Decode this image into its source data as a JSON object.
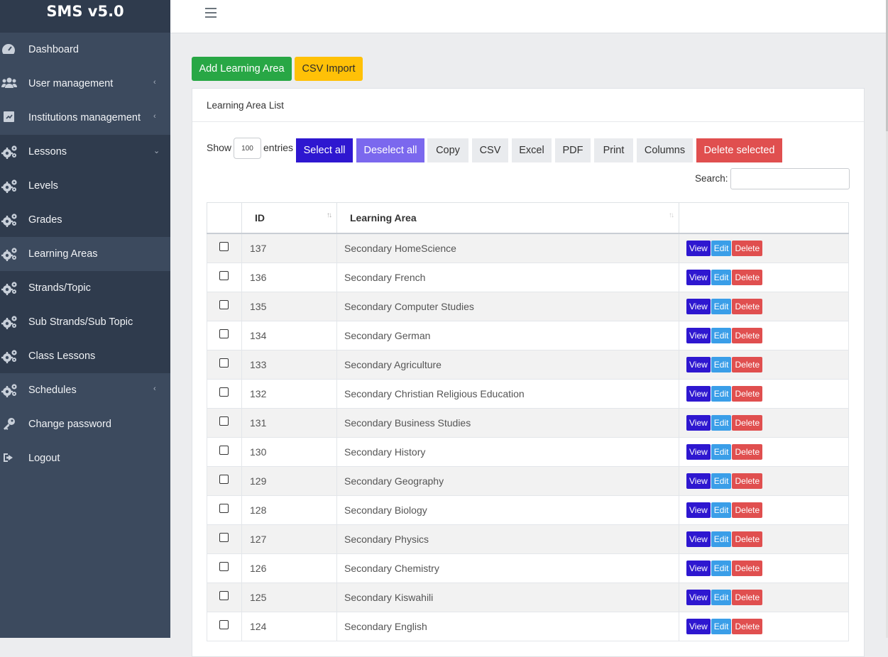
{
  "app": {
    "title": "SMS v5.0"
  },
  "sidebar": {
    "items": [
      {
        "label": "Dashboard",
        "icon": "dashboard-icon",
        "caret": ""
      },
      {
        "label": "User management",
        "icon": "users-icon",
        "caret": "‹"
      },
      {
        "label": "Institutions management",
        "icon": "institution-icon",
        "caret": "‹"
      },
      {
        "label": "Lessons",
        "icon": "cogs-icon",
        "caret": "⌄"
      },
      {
        "label": "Levels",
        "icon": "cogs-icon",
        "caret": ""
      },
      {
        "label": "Grades",
        "icon": "cogs-icon",
        "caret": ""
      },
      {
        "label": "Learning Areas",
        "icon": "cogs-icon",
        "caret": ""
      },
      {
        "label": "Strands/Topic",
        "icon": "cogs-icon",
        "caret": ""
      },
      {
        "label": "Sub Strands/Sub Topic",
        "icon": "cogs-icon",
        "caret": ""
      },
      {
        "label": "Class Lessons",
        "icon": "cogs-icon",
        "caret": ""
      },
      {
        "label": "Schedules",
        "icon": "cogs-icon",
        "caret": "‹"
      },
      {
        "label": "Change password",
        "icon": "key-icon",
        "caret": ""
      },
      {
        "label": "Logout",
        "icon": "logout-icon",
        "caret": ""
      }
    ]
  },
  "actions": {
    "add_label": "Add Learning Area",
    "csv_import_label": "CSV Import"
  },
  "card": {
    "title": "Learning Area List"
  },
  "datatable": {
    "show_label": "Show",
    "entries_label": "entries",
    "page_length": "100",
    "buttons": [
      "Select all",
      "Deselect all",
      "Copy",
      "CSV",
      "Excel",
      "PDF",
      "Print",
      "Columns",
      "Delete selected"
    ],
    "search_label": "Search:",
    "search_value": ""
  },
  "table": {
    "headers": [
      "",
      "ID",
      "Learning Area",
      ""
    ],
    "action_labels": {
      "view": "View",
      "edit": "Edit",
      "delete": "Delete"
    },
    "rows": [
      {
        "id": "137",
        "name": "Secondary HomeScience"
      },
      {
        "id": "136",
        "name": "Secondary French"
      },
      {
        "id": "135",
        "name": "Secondary Computer Studies"
      },
      {
        "id": "134",
        "name": "Secondary German"
      },
      {
        "id": "133",
        "name": "Secondary Agriculture"
      },
      {
        "id": "132",
        "name": "Secondary Christian Religious Education"
      },
      {
        "id": "131",
        "name": "Secondary Business Studies"
      },
      {
        "id": "130",
        "name": "Secondary History"
      },
      {
        "id": "129",
        "name": "Secondary Geography"
      },
      {
        "id": "128",
        "name": "Secondary Biology"
      },
      {
        "id": "127",
        "name": "Secondary Physics"
      },
      {
        "id": "126",
        "name": "Secondary Chemistry"
      },
      {
        "id": "125",
        "name": "Secondary Kiswahili"
      },
      {
        "id": "124",
        "name": "Secondary English"
      }
    ]
  },
  "colors": {
    "sidebar_bg": "#3c4a5e",
    "sidebar_group_bg": "#2f3b4d",
    "success": "#28a745",
    "warning": "#ffc107",
    "select_all": "#2e17d0",
    "deselect_all": "#7b68ee",
    "danger": "#e04f4f",
    "info": "#3a9ee8"
  }
}
